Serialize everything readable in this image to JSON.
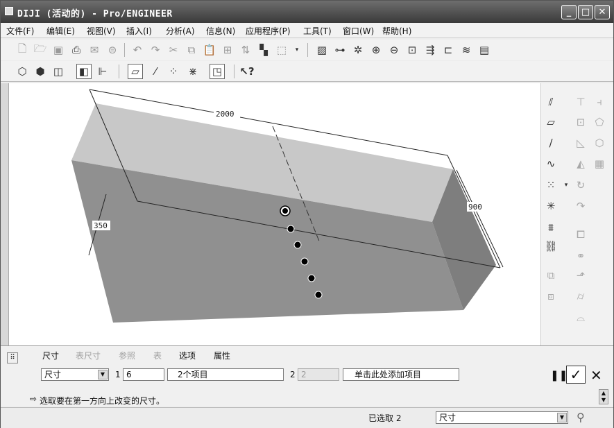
{
  "window": {
    "title": "DIJI (活动的) - Pro/ENGINEER",
    "controls": {
      "minimize": "_",
      "maximize": "□",
      "close": "✕"
    }
  },
  "menubar": {
    "items": [
      {
        "label": "文件(F)"
      },
      {
        "label": "编辑(E)"
      },
      {
        "label": "视图(V)"
      },
      {
        "label": "插入(I)"
      },
      {
        "label": "分析(A)"
      },
      {
        "label": "信息(N)"
      },
      {
        "label": "应用程序(P)"
      },
      {
        "label": "工具(T)"
      },
      {
        "label": "窗口(W)"
      },
      {
        "label": "帮助(H)"
      }
    ]
  },
  "toolbar1": {
    "icons": [
      "new-icon",
      "open-icon",
      "save-icon",
      "print-icon",
      "send-mail-icon",
      "send-link-icon",
      "undo-icon",
      "redo-icon",
      "cut-icon",
      "copy-icon",
      "paste-icon",
      "paste-special-icon",
      "regenerate-icon",
      "find-icon",
      "select-box-icon",
      "repaint-icon",
      "spin-center-icon",
      "orient-icon",
      "zoom-in-icon",
      "zoom-out-icon",
      "refit-icon",
      "reorient-icon",
      "saved-views-icon",
      "layers-icon",
      "view-manager-icon"
    ]
  },
  "toolbar2": {
    "icons": [
      "wireframe-icon",
      "hidden-line-icon",
      "no-hidden-icon",
      "shading-icon",
      "model-tree-icon",
      "datum-planes-icon",
      "datum-axes-icon",
      "datum-points-icon",
      "coordinate-system-icon",
      "annotation-icon",
      "context-help-icon"
    ]
  },
  "viewport": {
    "dimensions": {
      "length": "2000",
      "height": "900",
      "width": "350"
    },
    "pattern_point_count": 6
  },
  "rightbar": {
    "icons_left": [
      "datum-plane-tool-icon",
      "sketch-plane-icon",
      "datum-axis-icon",
      "datum-curve-icon",
      "datum-point-icon",
      "datum-csys-icon",
      "analysis-feature-icon",
      "chain-icon",
      "copy-feature-icon",
      "move-feature-icon"
    ],
    "icons_right": [
      "extrude-icon",
      "revolve-icon",
      "shell-icon",
      "rib-icon",
      "hole-icon",
      "draft-icon",
      "round-icon",
      "chamfer-icon",
      "pattern-icon",
      "mirror-icon",
      "merge-icon",
      "trim-icon",
      "offset-icon",
      "thicken-icon",
      "solidify-icon"
    ]
  },
  "dashboard": {
    "tabs": [
      {
        "label": "尺寸",
        "enabled": true
      },
      {
        "label": "表尺寸",
        "enabled": false
      },
      {
        "label": "参照",
        "enabled": false
      },
      {
        "label": "表",
        "enabled": false
      },
      {
        "label": "选项",
        "enabled": true
      },
      {
        "label": "属性",
        "enabled": true
      }
    ],
    "type_select": "尺寸",
    "dir1_label": "1",
    "dir1_count": "6",
    "dir1_items": "2个项目",
    "dir2_label": "2",
    "dir2_count": "2",
    "dir2_items": "单击此处添加项目",
    "pause_label": "❚❚",
    "ok_label": "✓",
    "cancel_label": "✕"
  },
  "message": "选取要在第一方向上改变的尺寸。",
  "status": {
    "selected": "已选取 2",
    "filter": "尺寸"
  }
}
